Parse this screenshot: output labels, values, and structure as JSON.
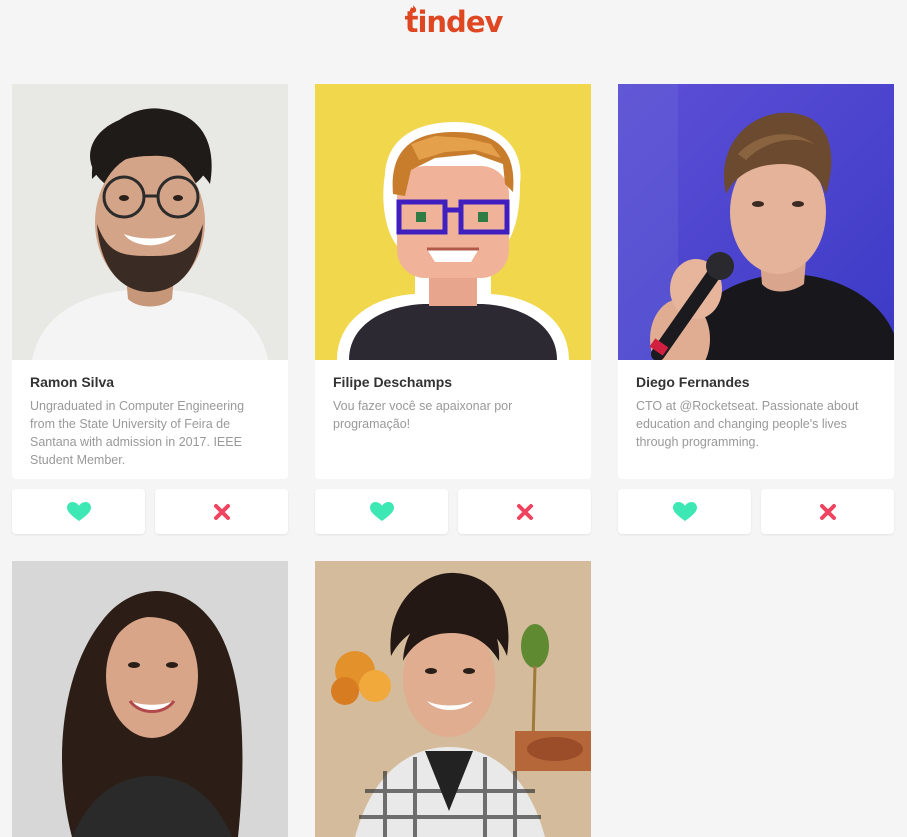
{
  "app": {
    "logo_text": "tindev",
    "logo_color": "#df4723"
  },
  "colors": {
    "like": "#3ee8b5",
    "dislike": "#f0435f",
    "name": "#333333",
    "bio": "#999999",
    "background": "#f5f5f5"
  },
  "users": [
    {
      "name": "Ramon Silva",
      "bio": "Ungraduated in Computer Engineering from the State University of Feira de Santana with admission in 2017. IEEE Student Member.",
      "like_icon": "heart-icon",
      "dislike_icon": "close-icon"
    },
    {
      "name": "Filipe Deschamps",
      "bio": "Vou fazer você se apaixonar por programação!",
      "like_icon": "heart-icon",
      "dislike_icon": "close-icon"
    },
    {
      "name": "Diego Fernandes",
      "bio": "CTO at @Rocketseat. Passionate about education and changing people's lives through programming.",
      "like_icon": "heart-icon",
      "dislike_icon": "close-icon"
    },
    {
      "name": "",
      "bio": ""
    },
    {
      "name": "",
      "bio": ""
    }
  ]
}
